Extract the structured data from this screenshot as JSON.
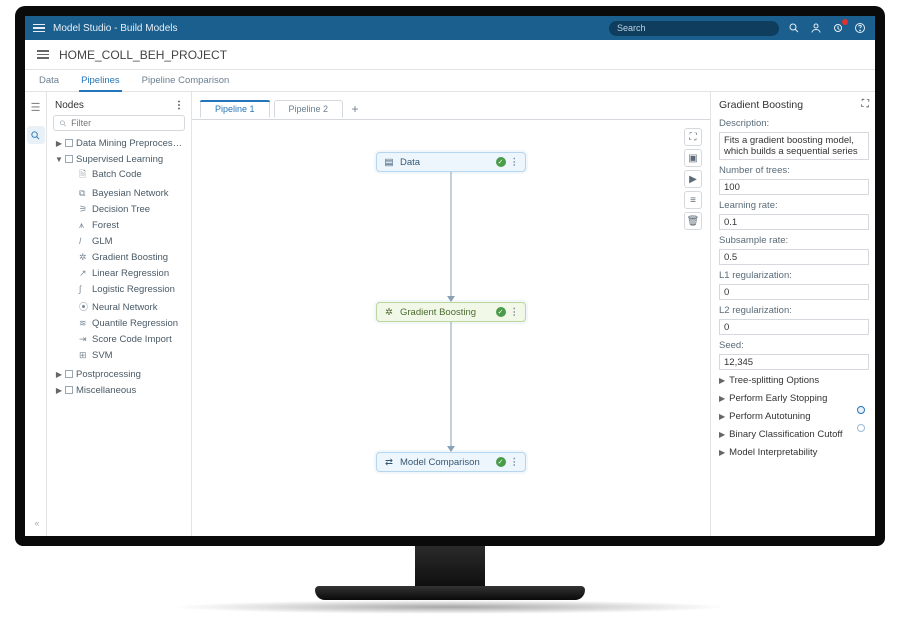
{
  "titlebar": {
    "app": "Model Studio - Build Models",
    "search_placeholder": "Search"
  },
  "project": {
    "name": "HOME_COLL_BEH_PROJECT"
  },
  "main_tabs": [
    {
      "label": "Data",
      "active": false
    },
    {
      "label": "Pipelines",
      "active": true
    },
    {
      "label": "Pipeline Comparison",
      "active": false
    }
  ],
  "nodes_panel": {
    "title": "Nodes",
    "filter_placeholder": "Filter",
    "groups": {
      "preprocessing": {
        "label": "Data Mining Preprocessing",
        "expanded": false
      },
      "supervised": {
        "label": "Supervised Learning",
        "expanded": true,
        "items": [
          "Batch Code",
          "Bayesian Network",
          "Decision Tree",
          "Forest",
          "GLM",
          "Gradient Boosting",
          "Linear Regression",
          "Logistic Regression",
          "Neural Network",
          "Quantile Regression",
          "Score Code Import",
          "SVM"
        ]
      },
      "postprocessing": {
        "label": "Postprocessing",
        "expanded": false
      },
      "misc": {
        "label": "Miscellaneous",
        "expanded": false
      }
    }
  },
  "pipeline_tabs": [
    {
      "label": "Pipeline 1",
      "active": true
    },
    {
      "label": "Pipeline 2",
      "active": false
    }
  ],
  "flow": {
    "n1": {
      "label": "Data"
    },
    "n2": {
      "label": "Gradient Boosting"
    },
    "n3": {
      "label": "Model Comparison"
    }
  },
  "props": {
    "title": "Gradient Boosting",
    "description_label": "Description:",
    "description_value": "Fits a gradient boosting model, which builds a sequential series of decision tre",
    "fields": [
      {
        "label": "Number of trees:",
        "value": "100"
      },
      {
        "label": "Learning rate:",
        "value": "0.1"
      },
      {
        "label": "Subsample rate:",
        "value": "0.5"
      },
      {
        "label": "L1 regularization:",
        "value": "0"
      },
      {
        "label": "L2 regularization:",
        "value": "0"
      },
      {
        "label": "Seed:",
        "value": "12,345"
      }
    ],
    "accordions": [
      "Tree-splitting Options",
      "Perform Early Stopping",
      "Perform Autotuning",
      "Binary Classification Cutoff",
      "Model Interpretability"
    ]
  }
}
